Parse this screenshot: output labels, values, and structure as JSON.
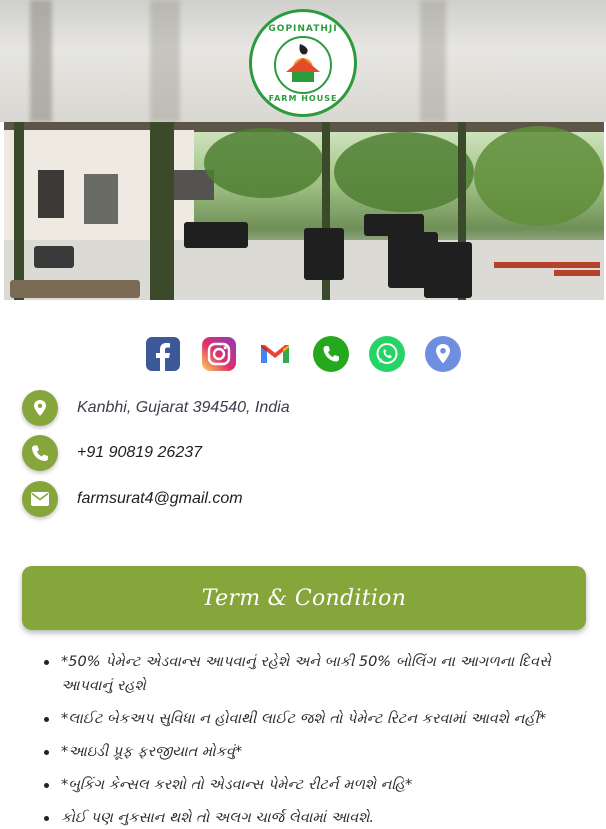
{
  "header": {
    "logo": {
      "top_text": "GOPINATHJI",
      "bottom_text": "FARM HOUSE",
      "color": "#2d9a3e"
    },
    "hero_image": "farm-house-patio-photo"
  },
  "social": {
    "items": [
      {
        "name": "facebook",
        "icon": "facebook-icon",
        "color": "#3b5998"
      },
      {
        "name": "instagram",
        "icon": "instagram-icon",
        "color": "#d6249f"
      },
      {
        "name": "gmail",
        "icon": "gmail-icon",
        "color": "#ea4335"
      },
      {
        "name": "phone",
        "icon": "phone-icon",
        "color": "#25a81d"
      },
      {
        "name": "whatsapp",
        "icon": "whatsapp-icon",
        "color": "#25d366"
      },
      {
        "name": "location",
        "icon": "map-pin-icon",
        "color": "#6f8ee0"
      }
    ]
  },
  "contact": {
    "address": "Kanbhi, Gujarat 394540, India",
    "phone": "+91 90819 26237",
    "email": "farmsurat4@gmail.com",
    "accent": "#86a53a"
  },
  "terms": {
    "button_label": "Term & Condition",
    "items": [
      "*50% પેમેન્ટ એડવાન્સ આપવાનું રહેશે અને બાકી 50% બોલિંગ ના આગળના દિવસે આપવાનું રહશે",
      "*લાઈટ બેકઅપ સુવિધા ન હોવાથી લાઈટ જશે તો પેમેન્ટ રિટન કરવામાં આવશે નહીં*",
      "*આઇડી પ્રૂફ ફરજીયાત મોકવું*",
      "*બુકિંગ કેન્સલ કરશો તો એડવાન્સ પેમેન્ટ રીટર્ન મળશે નહિ*",
      "કોઈ પણ નુકસાન થશે તો અલગ ચાર્જ લેવામાં આવશે."
    ]
  }
}
